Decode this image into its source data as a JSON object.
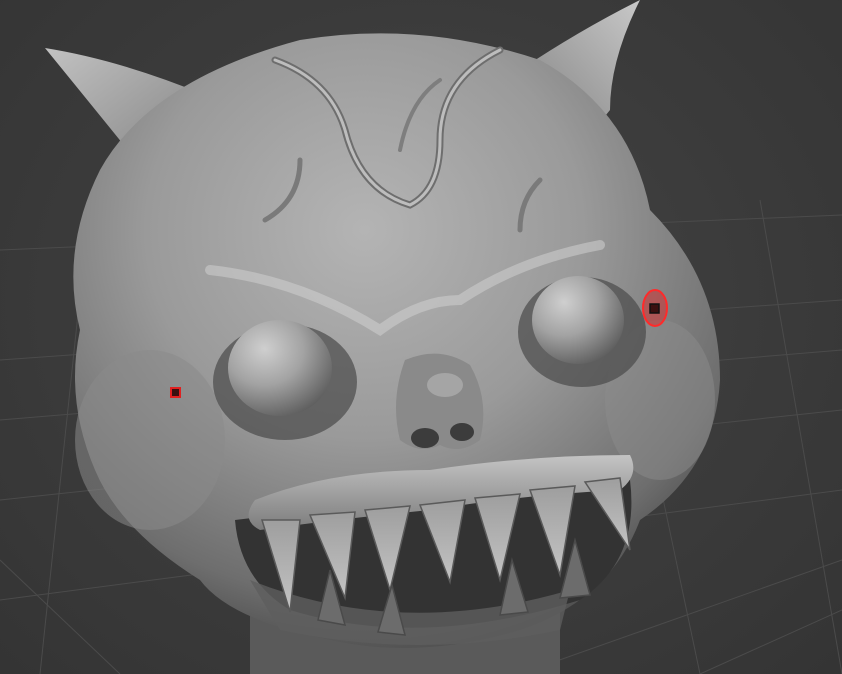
{
  "viewport": {
    "background": "#3b3b3b",
    "grid_color": "#4a4a4a",
    "mesh_base_color": "#8c8c8c",
    "symmetry_marker_color": "#e02020"
  },
  "scene": {
    "object": "sculpted-demon-head-mesh",
    "symmetry_markers": 2,
    "active_brush_cursor": "red-ring"
  }
}
